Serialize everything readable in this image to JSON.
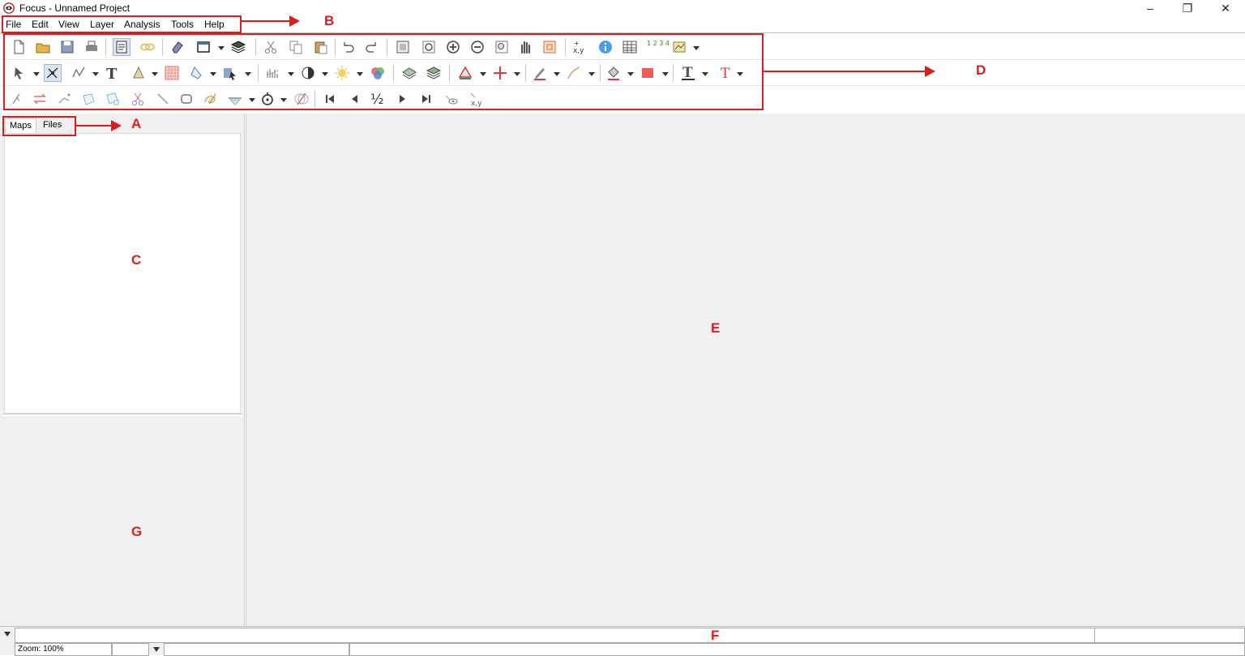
{
  "window": {
    "title": "Focus - Unnamed Project",
    "controls": {
      "minimize": "–",
      "restore": "❐",
      "close": "✕"
    }
  },
  "menu": [
    "File",
    "Edit",
    "View",
    "Layer",
    "Analysis",
    "Tools",
    "Help"
  ],
  "toolbar": {
    "row1_icons": [
      "new-file-icon",
      "open-folder-icon",
      "save-icon",
      "print-icon",
      "properties-icon",
      "link-icon",
      "eraser-icon",
      "window-icon",
      "layers-icon",
      "cut-icon",
      "copy-icon",
      "paste-icon",
      "undo-icon",
      "redo-icon",
      "zoom-extent-icon",
      "zoom-window-icon",
      "zoom-in-icon",
      "zoom-out-icon",
      "zoom-selection-icon",
      "pan-hand-icon",
      "overview-icon",
      "xy-coordinates-icon",
      "info-icon",
      "table-icon",
      "numbering-icon",
      "chart-style-icon"
    ],
    "row2_icons": [
      "select-arrow-icon",
      "edit-vertex-icon",
      "polyline-icon",
      "text-tool-icon",
      "digitize-icon",
      "grid-icon",
      "shape-icon",
      "selection-tool-icon",
      "histogram-icon",
      "contrast-icon",
      "brightness-icon",
      "color-balance-icon",
      "layer-stack-icon",
      "layer-stack-alt-icon",
      "symbol-icon",
      "crosshair-icon",
      "pen-icon",
      "line-style-icon",
      "fill-bucket-icon",
      "fill-color-icon",
      "font-icon",
      "text-color-icon"
    ],
    "row3_icons": [
      "move-vertex-icon",
      "swap-icon",
      "snap-icon",
      "polygon-icon",
      "polygon-edit-icon",
      "scissors-icon",
      "line-icon",
      "rectangle-icon",
      "freehand-icon",
      "filter-icon",
      "rotate-icon",
      "delete-shape-icon",
      "first-record-icon",
      "previous-record-icon",
      "half-icon",
      "next-record-icon",
      "last-record-icon",
      "eye-icon",
      "xy-icon"
    ],
    "half_label": "½",
    "xy_label": "x,y",
    "numbering_label": "1 2 3 4",
    "text_label": "T"
  },
  "left_panel": {
    "tabs": [
      {
        "label": "Maps",
        "active": true
      },
      {
        "label": "Files",
        "active": false
      }
    ]
  },
  "status": {
    "zoom": "Zoom: 100%"
  },
  "annotations": {
    "A": "A",
    "B": "B",
    "C": "C",
    "D": "D",
    "E": "E",
    "F": "F",
    "G": "G"
  },
  "colors": {
    "annotation": "#e01b1b",
    "panel_bg": "#f0f0f0",
    "selected_tool": "#dbe6f2"
  }
}
